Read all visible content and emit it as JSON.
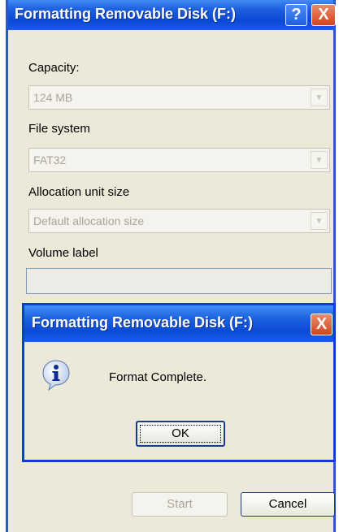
{
  "main_window": {
    "title": "Formatting Removable Disk (F:)",
    "help_label": "?",
    "close_label": "X",
    "capacity": {
      "label": "Capacity:",
      "value": "124 MB"
    },
    "file_system": {
      "label": "File system",
      "value": "FAT32"
    },
    "allocation": {
      "label": "Allocation unit size",
      "value": "Default allocation size"
    },
    "volume": {
      "label": "Volume label",
      "value": ""
    },
    "start_label": "Start",
    "cancel_label": "Cancel"
  },
  "dialog": {
    "title": "Formatting Removable Disk (F:)",
    "close_label": "X",
    "message": "Format Complete.",
    "ok_label": "OK"
  },
  "icons": {
    "dropdown": "chevron-down-icon",
    "info": "information-icon"
  },
  "colors": {
    "title_bar": "#0a49d6",
    "close_button": "#d1441c",
    "window_face": "#ece9d8"
  }
}
